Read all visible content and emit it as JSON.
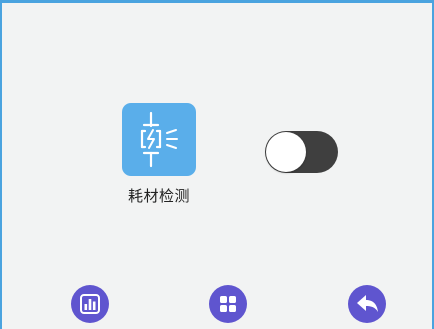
{
  "feature": {
    "label": "耗材检测",
    "icon": "consumable-sensor-icon",
    "tile_color": "#5aaeea"
  },
  "toggle": {
    "state": "off",
    "track_color": "#3f3f3f",
    "knob_color": "#ffffff"
  },
  "bottom_nav": {
    "button_color": "#5f55cf",
    "items": [
      {
        "icon": "bar-chart-icon"
      },
      {
        "icon": "grid-menu-icon"
      },
      {
        "icon": "back-arrow-icon"
      }
    ]
  },
  "frame": {
    "border_color": "#4aa3df",
    "background": "#f2f3f3"
  }
}
